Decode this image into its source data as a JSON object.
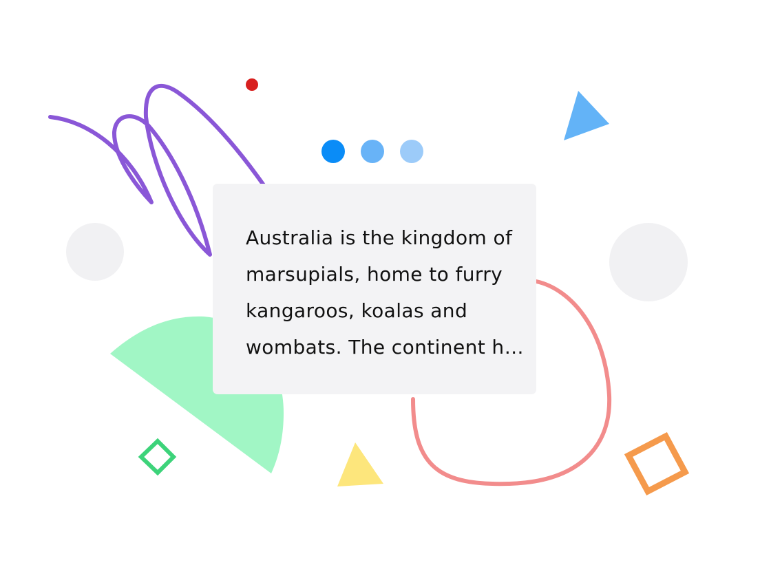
{
  "card": {
    "text": "Australia is the kingdom of marsupials, home to furry kangaroos, koalas and wombats. The continent has many other unique animals."
  },
  "pager": {
    "dots": [
      {
        "color": "#0a8cf7"
      },
      {
        "color": "#68b3f7"
      },
      {
        "color": "#9ccbf9"
      }
    ]
  },
  "decor": {
    "colors": {
      "purple": "#8a57d7",
      "red_dot": "#d8201f",
      "blue_triangle": "#63b3f7",
      "grey_circle": "#f1f1f3",
      "green_shape": "#a1f6c5",
      "coral_loop": "#f28c8c",
      "green_diamond": "#3dd37a",
      "yellow_triangle": "#fde67c",
      "orange_square": "#f59a4c"
    }
  }
}
